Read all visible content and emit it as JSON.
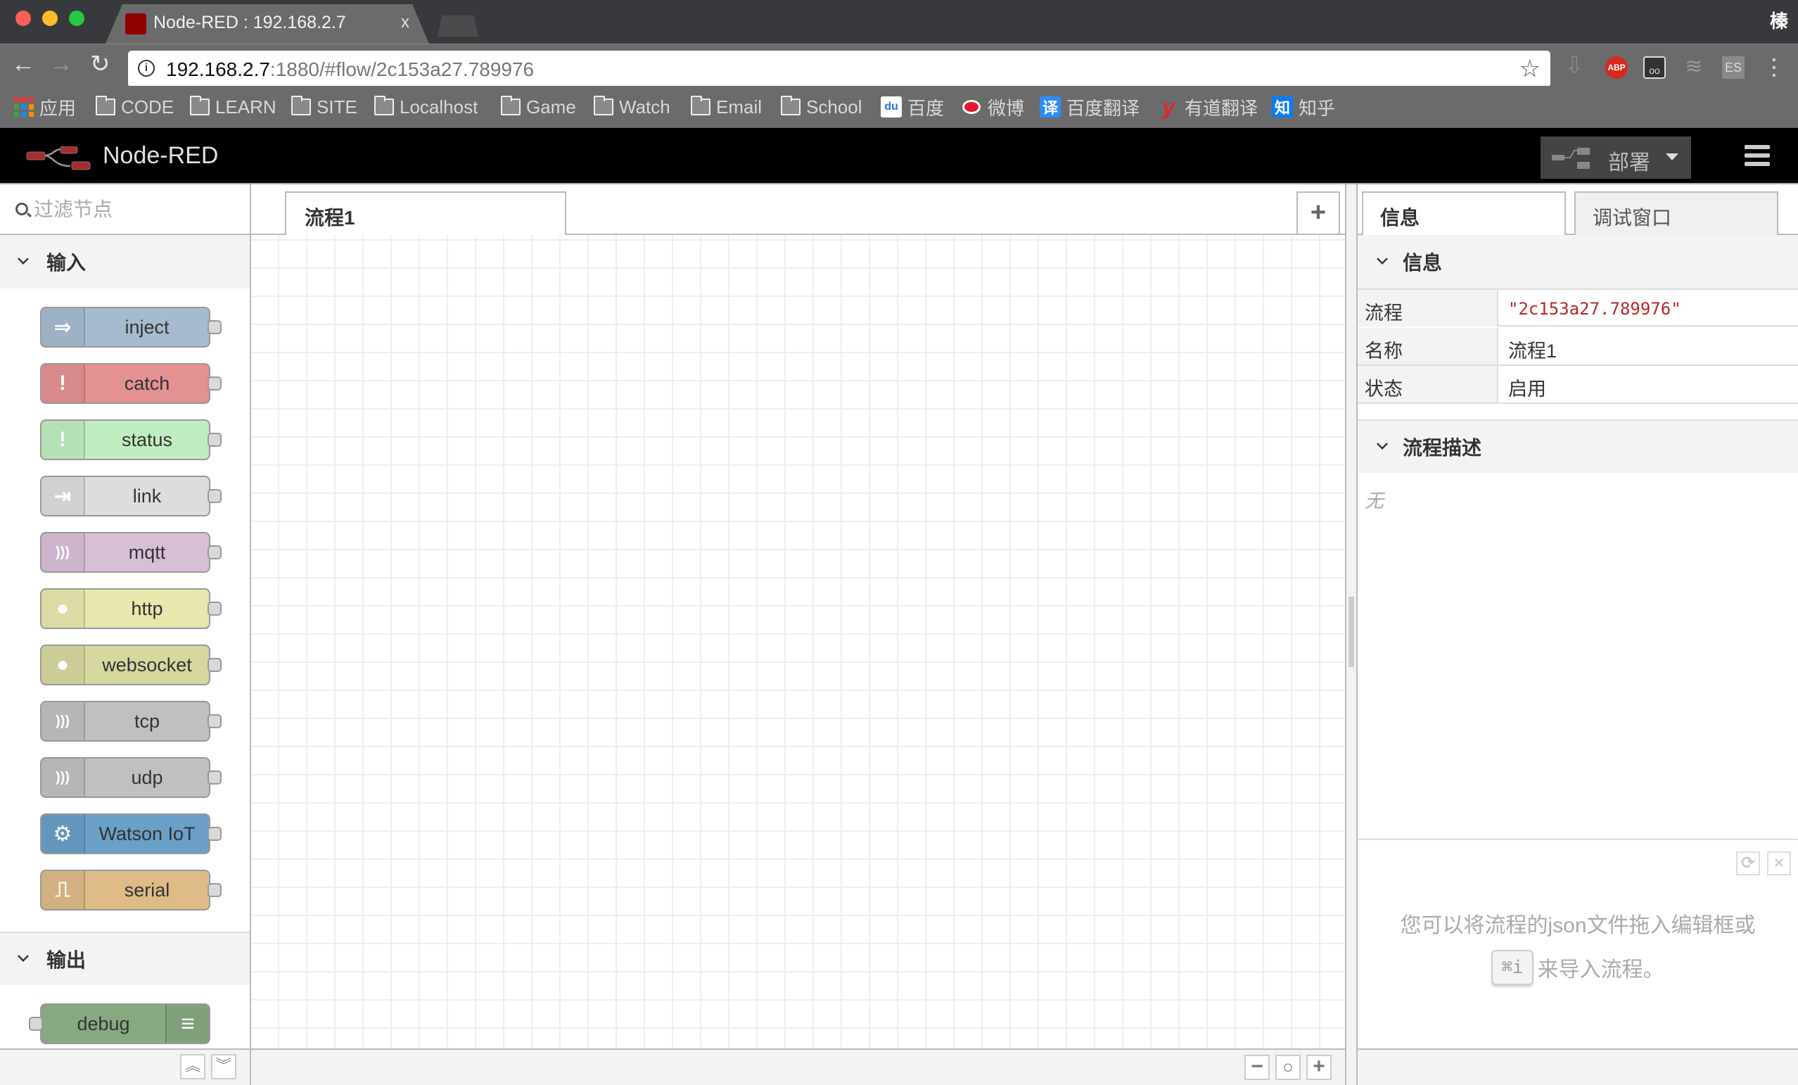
{
  "browser": {
    "tab_title": "Node-RED : 192.168.2.7",
    "tab_close": "x",
    "profile_initial": "榛",
    "url_host": "192.168.2.7",
    "url_rest": ":1880/#flow/2c153a27.789976",
    "nav": {
      "back": "←",
      "forward": "→",
      "reload": "↻",
      "star": "☆"
    },
    "extensions": [
      {
        "name": "download-icon",
        "label": "⇩"
      },
      {
        "name": "adblock-plus-icon",
        "label": "ABP"
      },
      {
        "name": "glasses-extension-icon",
        "label": "oo"
      },
      {
        "name": "database-extension-icon",
        "label": "≋"
      },
      {
        "name": "es-extension-icon",
        "label": "ES"
      },
      {
        "name": "more-menu-icon",
        "label": "⋮"
      }
    ],
    "bookmarks": [
      {
        "label": "应用",
        "icon": "apps-grid"
      },
      {
        "label": "CODE",
        "icon": "folder"
      },
      {
        "label": "LEARN",
        "icon": "folder"
      },
      {
        "label": "SITE",
        "icon": "folder"
      },
      {
        "label": "Localhost",
        "icon": "folder"
      },
      {
        "label": "Game",
        "icon": "folder"
      },
      {
        "label": "Watch",
        "icon": "folder"
      },
      {
        "label": "Email",
        "icon": "folder"
      },
      {
        "label": "School",
        "icon": "folder"
      },
      {
        "label": "百度",
        "icon": "baidu"
      },
      {
        "label": "微博",
        "icon": "weibo"
      },
      {
        "label": "百度翻译",
        "icon": "baidu-translate",
        "glyph": "译"
      },
      {
        "label": "有道翻译",
        "icon": "youdao",
        "glyph": "y"
      },
      {
        "label": "知乎",
        "icon": "zhihu",
        "glyph": "知"
      }
    ]
  },
  "header": {
    "title": "Node-RED",
    "deploy_label": "部署",
    "colors": {
      "logo": "#aa2c2c",
      "deploy_bg": "#444444"
    }
  },
  "palette": {
    "search_placeholder": "过滤节点",
    "categories": [
      {
        "label": "输入",
        "nodes": [
          {
            "label": "inject",
            "color": "#a6bbcf",
            "icon": "arrow-in-icon",
            "glyph": "⇒"
          },
          {
            "label": "catch",
            "color": "#e49191",
            "icon": "alert-icon",
            "glyph": "!"
          },
          {
            "label": "status",
            "color": "#c0edc0",
            "icon": "alert-icon",
            "glyph": "!"
          },
          {
            "label": "link",
            "color": "#dddddd",
            "icon": "link-in-icon",
            "glyph": "⇥"
          },
          {
            "label": "mqtt",
            "color": "#d8bfd8",
            "icon": "bridge-icon",
            "glyph": ")))"
          },
          {
            "label": "http",
            "color": "#e7e7ae",
            "icon": "globe-icon",
            "glyph": "●"
          },
          {
            "label": "websocket",
            "color": "#d7d7a0",
            "icon": "globe-icon",
            "glyph": "●"
          },
          {
            "label": "tcp",
            "color": "#c0c0c0",
            "icon": "bridge-dash-icon",
            "glyph": ")))"
          },
          {
            "label": "udp",
            "color": "#c0c0c0",
            "icon": "bridge-dash-icon",
            "glyph": ")))"
          },
          {
            "label": "Watson IoT",
            "color": "#6a9fc7",
            "icon": "chip-icon",
            "glyph": "⚙"
          },
          {
            "label": "serial",
            "color": "#debb87",
            "icon": "serial-icon",
            "glyph": "⎍"
          }
        ]
      },
      {
        "label": "输出",
        "nodes": [
          {
            "label": "debug",
            "color": "#87a980",
            "icon": "debug-list-icon",
            "glyph": "≡"
          }
        ]
      }
    ],
    "footer": {
      "collapse_all": "︽",
      "expand_all": "︾"
    }
  },
  "workspace": {
    "tabs": [
      {
        "label": "流程1",
        "active": true
      }
    ],
    "add_tab": "+",
    "zoom": {
      "out": "−",
      "reset": "○",
      "in": "+"
    }
  },
  "sidebar": {
    "tabs": [
      {
        "label": "信息",
        "active": true
      },
      {
        "label": "调试窗口",
        "active": false
      }
    ],
    "info_section": {
      "title": "信息",
      "rows": [
        {
          "key": "流程",
          "value": "\"2c153a27.789976\""
        },
        {
          "key": "名称",
          "value": "流程1"
        },
        {
          "key": "状态",
          "value": "启用"
        }
      ]
    },
    "desc_section": {
      "title": "流程描述",
      "content": "无"
    },
    "help": {
      "line1": "您可以将流程的json文件拖入编辑框或",
      "shortcut": "⌘i",
      "line2": "来导入流程。",
      "refresh": "⟳",
      "close": "×"
    }
  }
}
